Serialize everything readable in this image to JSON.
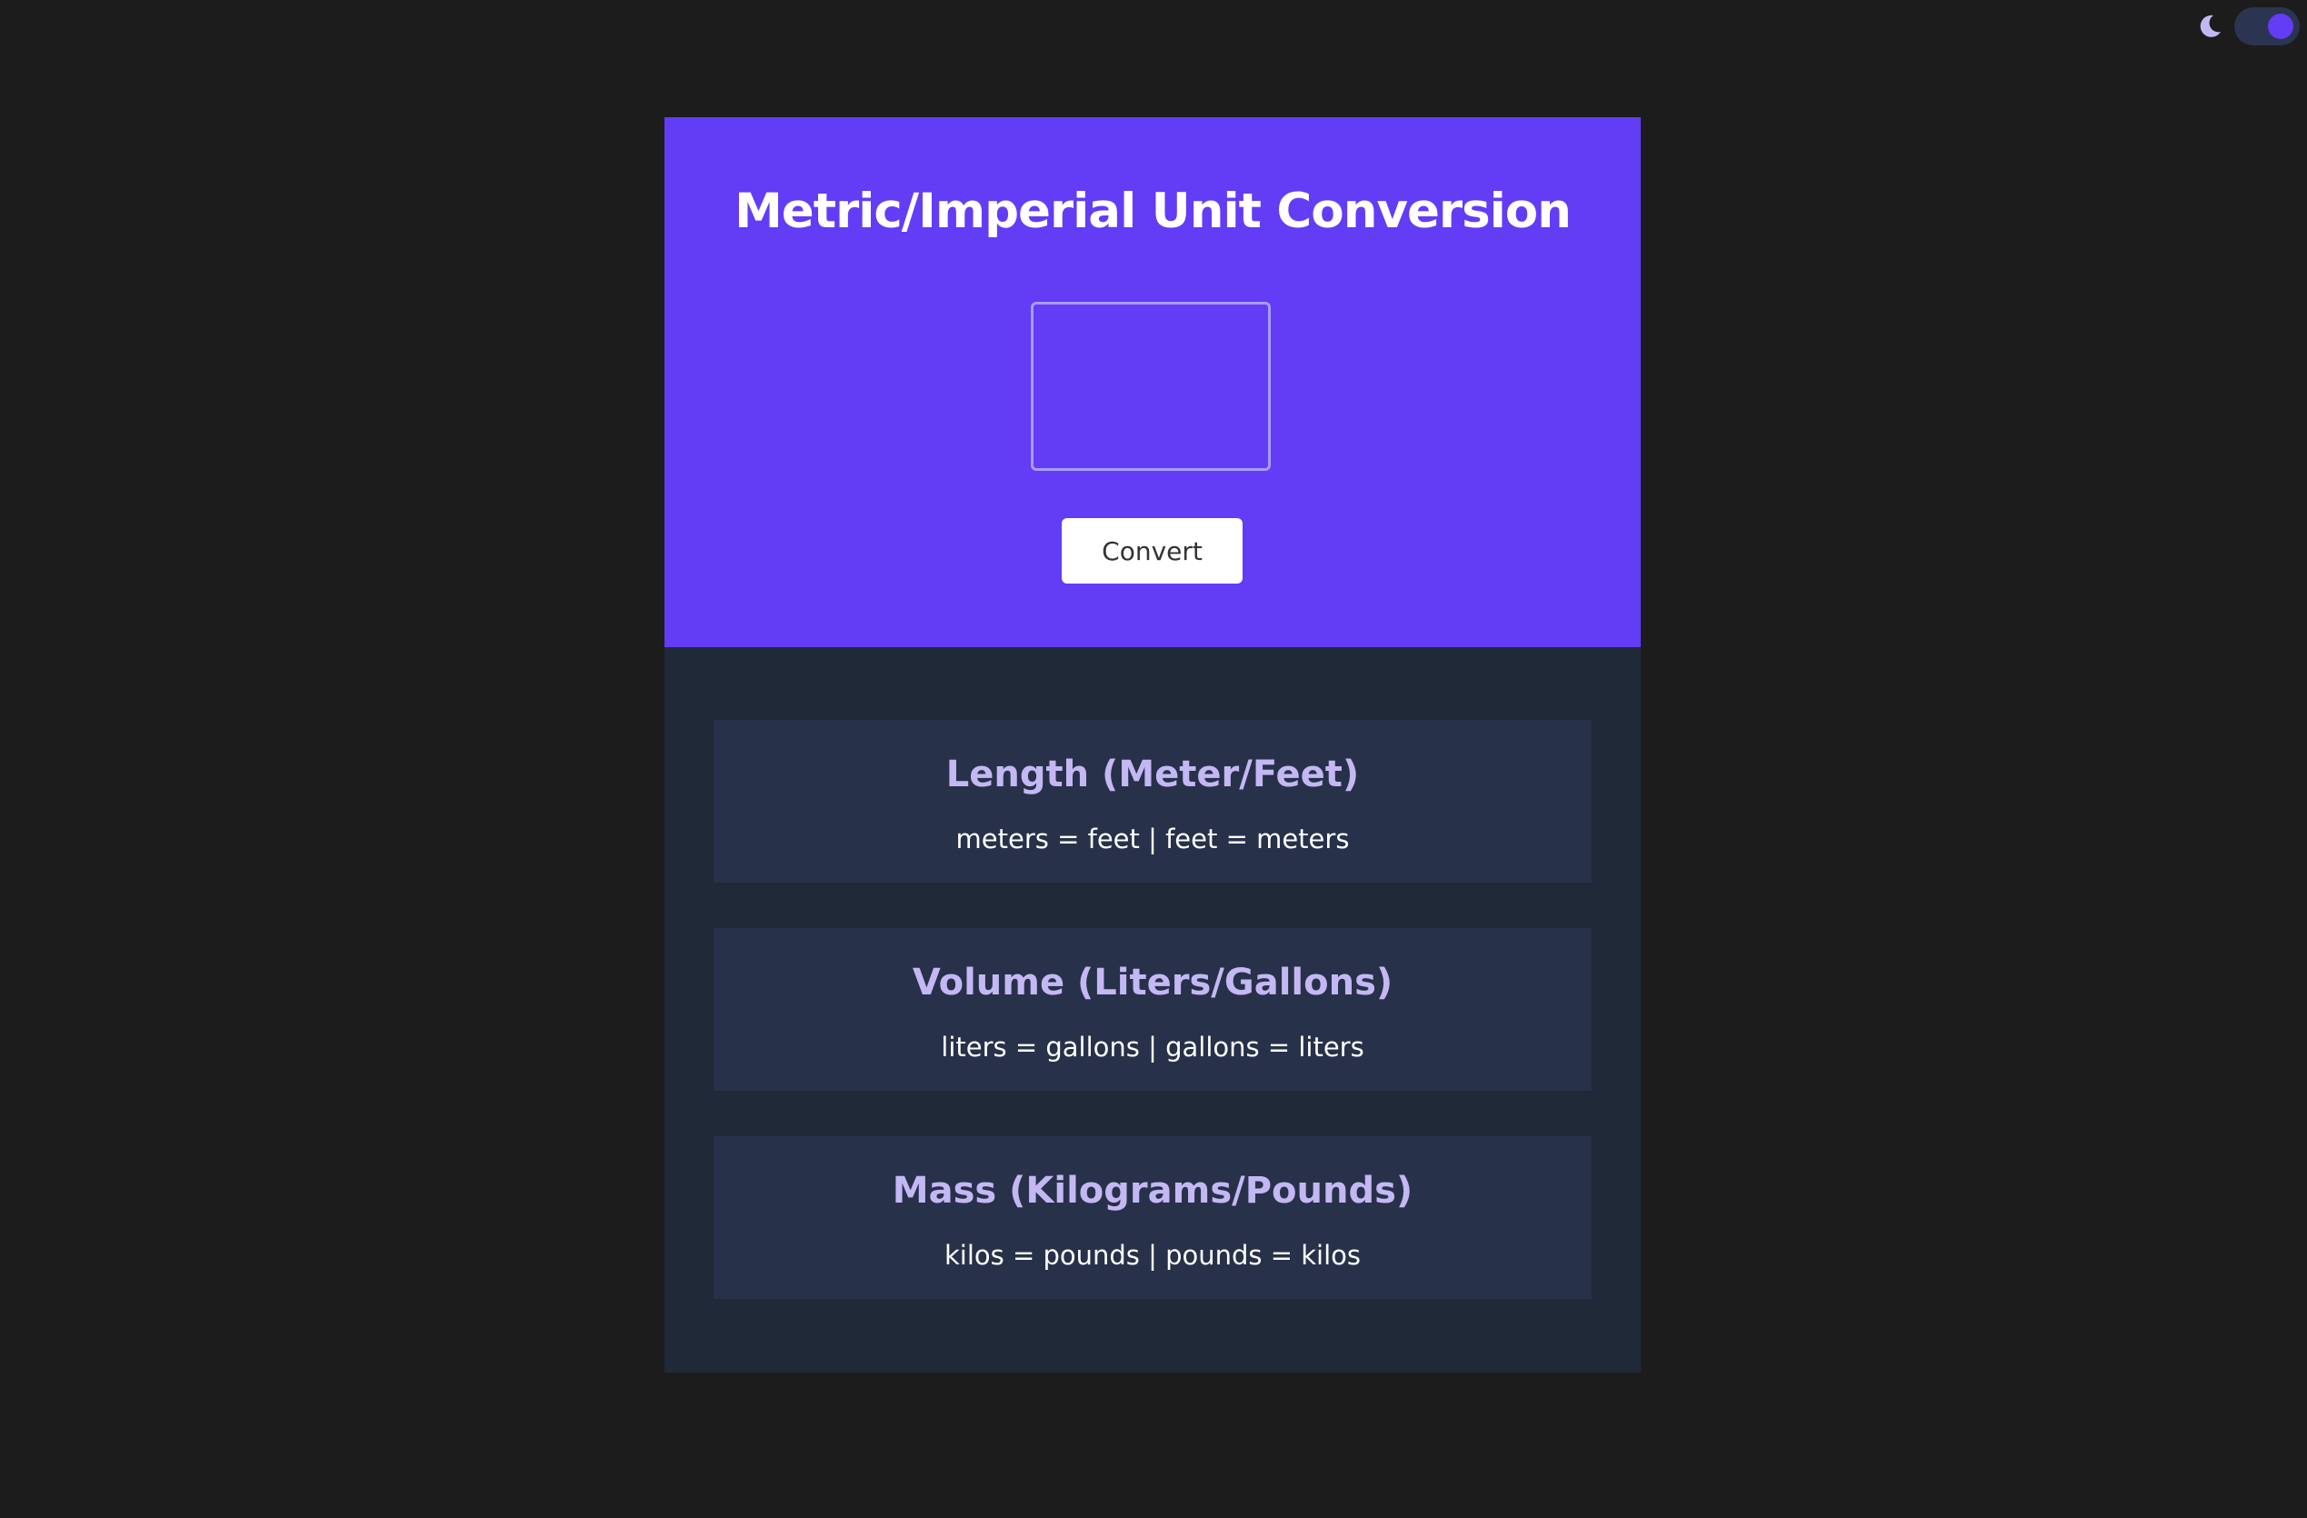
{
  "theme_toggle": {
    "icon": "moon-icon",
    "state": "on",
    "knob_color": "#633cf6"
  },
  "header": {
    "title": "Metric/Imperial Unit Conversion",
    "input_value": "",
    "convert_label": "Convert",
    "background_color": "#633cf6"
  },
  "results": [
    {
      "title": "Length (Meter/Feet)",
      "text": "meters = feet | feet = meters"
    },
    {
      "title": "Volume (Liters/Gallons)",
      "text": "liters = gallons | gallons = liters"
    },
    {
      "title": "Mass (Kilograms/Pounds)",
      "text": "kilos = pounds | pounds = kilos"
    }
  ],
  "colors": {
    "page_background": "#1c1c1c",
    "results_background": "#1f2937",
    "panel_background": "#273149",
    "panel_title": "#c4b8f4",
    "panel_text": "#ffffff"
  }
}
